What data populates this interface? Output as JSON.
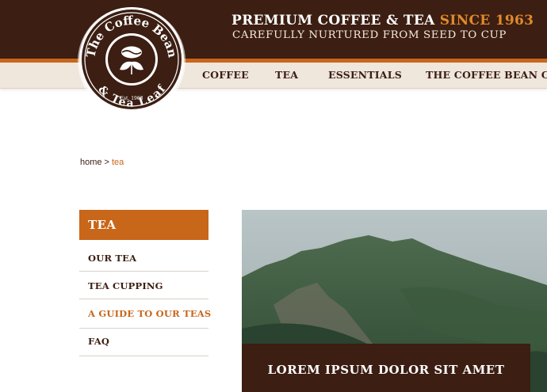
{
  "header": {
    "tagline_main": "PREMIUM COFFEE & TEA",
    "tagline_accent": "SINCE 1963",
    "tagline_sub": "CAREFULLY NURTURED FROM SEED TO CUP"
  },
  "logo": {
    "top_text": "The Coffee Bean",
    "bottom_text": "& Tea Leaf",
    "est": "Est. 1963",
    "icon": "coffee-bean-tea-leaf-emblem"
  },
  "nav": {
    "items": [
      {
        "label": "COFFEE"
      },
      {
        "label": "TEA"
      },
      {
        "label": "ESSENTIALS"
      },
      {
        "label": "THE COFFEE BEAN CAF"
      }
    ]
  },
  "breadcrumb": {
    "home": "home",
    "separator": ">",
    "current": "tea"
  },
  "sidebar": {
    "title": "TEA",
    "items": [
      {
        "label": "OUR TEA",
        "active": false
      },
      {
        "label": "TEA CUPPING",
        "active": false
      },
      {
        "label": "A GUIDE TO OUR TEAS",
        "active": true
      },
      {
        "label": "FAQ",
        "active": false
      }
    ]
  },
  "hero": {
    "caption": "LOREM IPSUM DOLOR SIT AMET"
  },
  "colors": {
    "brown": "#3c1e12",
    "orange": "#c8661a",
    "nav_bg": "#efe6dc"
  }
}
